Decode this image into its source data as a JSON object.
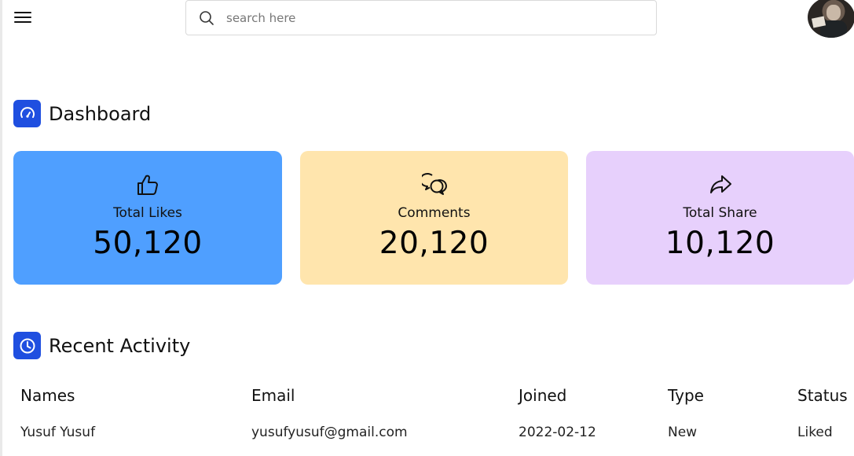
{
  "topbar": {
    "search_placeholder": "search here",
    "avatar_alt": ""
  },
  "dashboard": {
    "title": "Dashboard",
    "cards": [
      {
        "label": "Total Likes",
        "value": "50,120",
        "icon": "thumbs-up-icon",
        "color": "#4f9fff"
      },
      {
        "label": "Comments",
        "value": "20,120",
        "icon": "chat-bubbles-icon",
        "color": "#ffe5ad"
      },
      {
        "label": "Total Share",
        "value": "10,120",
        "icon": "share-arrow-icon",
        "color": "#e7d0fc"
      }
    ]
  },
  "activity": {
    "title": "Recent Activity",
    "columns": [
      "Names",
      "Email",
      "Joined",
      "Type",
      "Status"
    ],
    "rows": [
      {
        "name": "Yusuf Yusuf",
        "email": "yusufyusuf@gmail.com",
        "joined": "2022-02-12",
        "type": "New",
        "status": "Liked"
      }
    ]
  },
  "colors": {
    "accent": "#1f4fe0"
  }
}
